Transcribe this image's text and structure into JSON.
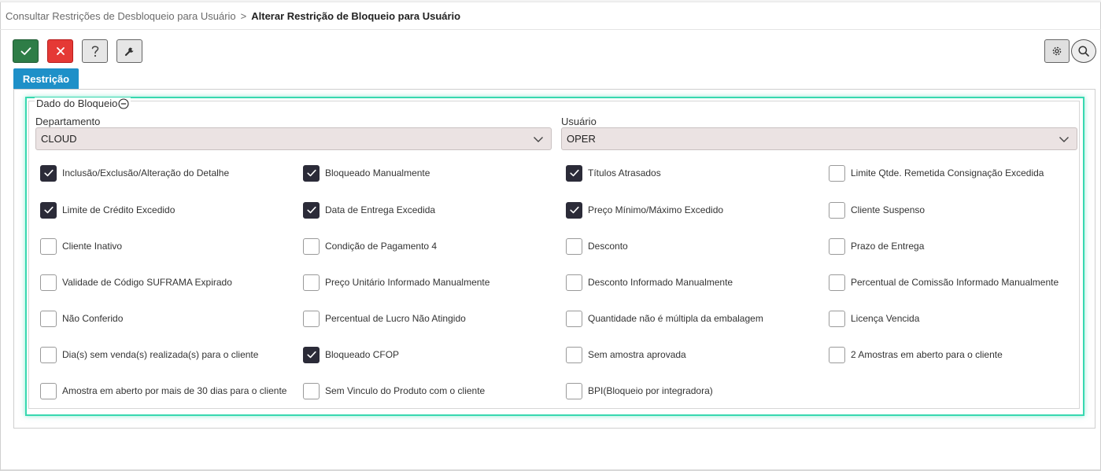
{
  "breadcrumb": {
    "parent": "Consultar Restrições de Desbloqueio para Usuário",
    "separator": ">",
    "current": "Alterar Restrição de Bloqueio para Usuário"
  },
  "toolbar": {
    "confirm_icon": "check-icon",
    "cancel_icon": "close-icon",
    "help_icon": "question-icon",
    "tool_icon": "wrench-icon",
    "settings_icon": "gear-icon",
    "search_icon": "search-icon"
  },
  "tabs": [
    {
      "label": "Restrição",
      "active": true
    }
  ],
  "section": {
    "title": "Dado do Bloqueio",
    "collapse_icon": "minus-circle-icon"
  },
  "fields": {
    "departamento": {
      "label": "Departamento",
      "value": "CLOUD"
    },
    "usuario": {
      "label": "Usuário",
      "value": "OPER"
    }
  },
  "colors": {
    "accent": "#1e90c8",
    "highlight": "#37d8b0",
    "confirm": "#2e7d47",
    "cancel": "#e53935"
  },
  "checkboxes": [
    [
      {
        "label": "Inclusão/Exclusão/Alteração do Detalhe",
        "checked": true
      },
      {
        "label": "Bloqueado Manualmente",
        "checked": true
      },
      {
        "label": "Títulos Atrasados",
        "checked": true
      },
      {
        "label": "Limite Qtde. Remetida Consignação Excedida",
        "checked": false
      }
    ],
    [
      {
        "label": "Limite de Crédito Excedido",
        "checked": true
      },
      {
        "label": "Data de Entrega Excedida",
        "checked": true
      },
      {
        "label": "Preço Mínimo/Máximo Excedido",
        "checked": true
      },
      {
        "label": "Cliente Suspenso",
        "checked": false
      }
    ],
    [
      {
        "label": "Cliente Inativo",
        "checked": false
      },
      {
        "label": "Condição de Pagamento 4",
        "checked": false
      },
      {
        "label": "Desconto",
        "checked": false
      },
      {
        "label": "Prazo de Entrega",
        "checked": false
      }
    ],
    [
      {
        "label": "Validade de Código SUFRAMA Expirado",
        "checked": false
      },
      {
        "label": "Preço Unitário Informado Manualmente",
        "checked": false
      },
      {
        "label": "Desconto Informado Manualmente",
        "checked": false
      },
      {
        "label": "Percentual de Comissão Informado Manualmente",
        "checked": false
      }
    ],
    [
      {
        "label": "Não Conferido",
        "checked": false
      },
      {
        "label": "Percentual de Lucro Não Atingido",
        "checked": false
      },
      {
        "label": "Quantidade não é múltipla da embalagem",
        "checked": false
      },
      {
        "label": "Licença Vencida",
        "checked": false
      }
    ],
    [
      {
        "label": "Dia(s) sem venda(s) realizada(s) para o cliente",
        "checked": false
      },
      {
        "label": "Bloqueado CFOP",
        "checked": true
      },
      {
        "label": "Sem amostra aprovada",
        "checked": false
      },
      {
        "label": "2 Amostras em aberto para o cliente",
        "checked": false
      }
    ],
    [
      {
        "label": "Amostra em aberto por mais de 30 dias para o cliente",
        "checked": false
      },
      {
        "label": "Sem Vinculo do Produto com o cliente",
        "checked": false
      },
      {
        "label": "BPI(Bloqueio por integradora)",
        "checked": false
      }
    ]
  ]
}
